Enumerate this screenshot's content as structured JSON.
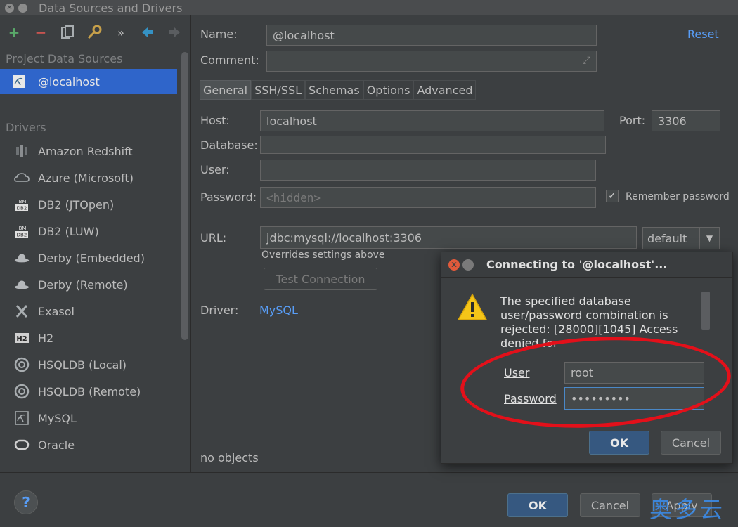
{
  "window": {
    "title": "Data Sources and Drivers"
  },
  "sidebar": {
    "project_label": "Project Data Sources",
    "selected_item": "@localhost",
    "drivers_label": "Drivers",
    "drivers": [
      {
        "label": "Amazon Redshift",
        "icon": "redshift-icon"
      },
      {
        "label": "Azure (Microsoft)",
        "icon": "azure-icon"
      },
      {
        "label": "DB2 (JTOpen)",
        "icon": "ibm-db2-icon"
      },
      {
        "label": "DB2 (LUW)",
        "icon": "ibm-db2-icon"
      },
      {
        "label": "Derby (Embedded)",
        "icon": "derby-icon"
      },
      {
        "label": "Derby (Remote)",
        "icon": "derby-icon"
      },
      {
        "label": "Exasol",
        "icon": "exasol-icon"
      },
      {
        "label": "H2",
        "icon": "h2-icon"
      },
      {
        "label": "HSQLDB (Local)",
        "icon": "hsqldb-icon"
      },
      {
        "label": "HSQLDB (Remote)",
        "icon": "hsqldb-icon"
      },
      {
        "label": "MySQL",
        "icon": "mysql-icon"
      },
      {
        "label": "Oracle",
        "icon": "oracle-icon"
      }
    ],
    "ibm_icon_text": "IBM\nDB2",
    "h2_icon_text": "H2"
  },
  "form": {
    "name_label": "Name:",
    "name_value": "@localhost",
    "reset_label": "Reset",
    "comment_label": "Comment:",
    "comment_value": "",
    "tabs": [
      "General",
      "SSH/SSL",
      "Schemas",
      "Options",
      "Advanced"
    ],
    "host_label": "Host:",
    "host_value": "localhost",
    "port_label": "Port:",
    "port_value": "3306",
    "database_label": "Database:",
    "database_value": "",
    "user_label": "User:",
    "user_value": "",
    "password_label": "Password:",
    "password_placeholder": "<hidden>",
    "remember_label": "Remember password",
    "remember_checked": true,
    "url_label": "URL:",
    "url_value": "jdbc:mysql://localhost:3306",
    "url_mode": "default",
    "url_hint": "Overrides settings above",
    "test_connection_label": "Test Connection",
    "driver_label": "Driver:",
    "driver_value": "MySQL",
    "no_objects": "no objects"
  },
  "footer": {
    "help_label": "?",
    "ok_label": "OK",
    "cancel_label": "Cancel",
    "apply_label": "Apply"
  },
  "dialog": {
    "title": "Connecting to '@localhost'...",
    "message": "The specified database user/password combination is rejected: [28000][1045] Access denied for",
    "user_label": "User",
    "user_value": "root",
    "password_label": "Password",
    "password_value": "•••••••••",
    "ok_label": "OK",
    "cancel_label": "Cancel"
  },
  "watermark": "奥多云",
  "colors": {
    "accent": "#2f65ca",
    "link": "#589df6",
    "highlight_ellipse": "#e3101a",
    "warning": "#f5c518"
  }
}
